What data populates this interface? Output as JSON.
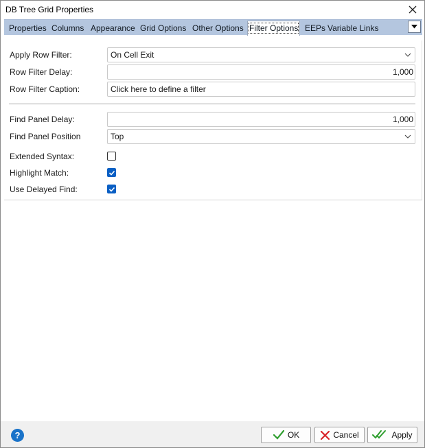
{
  "window": {
    "title": "DB Tree Grid Properties"
  },
  "tabs": [
    {
      "label": "Properties"
    },
    {
      "label": "Columns"
    },
    {
      "label": "Appearance"
    },
    {
      "label": "Grid Options"
    },
    {
      "label": "Other Options"
    },
    {
      "label": "Filter Options",
      "active": true
    },
    {
      "label": "EEPs"
    },
    {
      "label": "Variable Links"
    }
  ],
  "form": {
    "apply_row_filter": {
      "label": "Apply Row Filter:",
      "value": "On Cell Exit"
    },
    "row_filter_delay": {
      "label": "Row Filter Delay:",
      "value": "1,000"
    },
    "row_filter_caption": {
      "label": "Row Filter Caption:",
      "value": "Click here to define a filter"
    },
    "find_panel_delay": {
      "label": "Find Panel Delay:",
      "value": "1,000"
    },
    "find_panel_position": {
      "label": "Find Panel Position",
      "value": "Top"
    },
    "extended_syntax": {
      "label": "Extended Syntax:",
      "checked": false
    },
    "highlight_match": {
      "label": "Highlight Match:",
      "checked": true
    },
    "use_delayed_find": {
      "label": "Use Delayed Find:",
      "checked": true
    }
  },
  "footer": {
    "help_glyph": "?",
    "ok_label": "OK",
    "cancel_label": "Cancel",
    "apply_label": "Apply"
  },
  "colors": {
    "tab_strip": "#b4c6df",
    "checkbox_checked": "#0a5fc4",
    "ok_check": "#2e9e2e",
    "cancel_x": "#d9262c",
    "help_icon": "#1a73c9"
  }
}
